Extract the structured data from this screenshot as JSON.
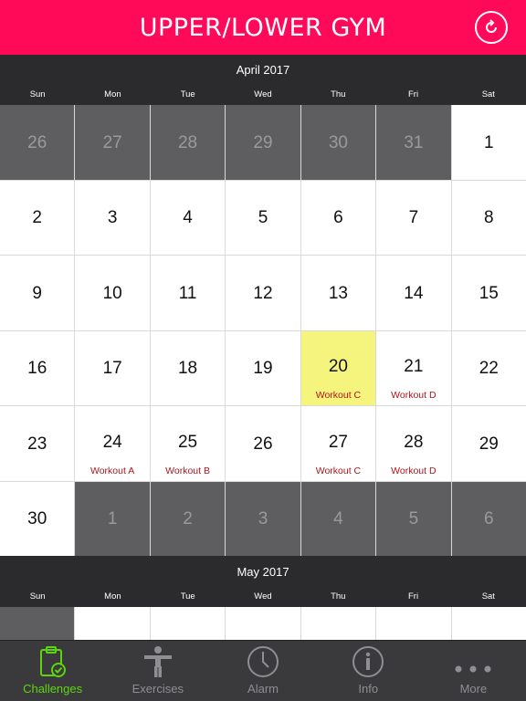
{
  "header": {
    "title": "UPPER/LOWER GYM",
    "refresh_icon": "refresh-icon"
  },
  "april": {
    "title": "April 2017",
    "weekdays": [
      "Sun",
      "Mon",
      "Tue",
      "Wed",
      "Thu",
      "Fri",
      "Sat"
    ],
    "cells": [
      {
        "day": "26",
        "other": true,
        "label": ""
      },
      {
        "day": "27",
        "other": true,
        "label": ""
      },
      {
        "day": "28",
        "other": true,
        "label": ""
      },
      {
        "day": "29",
        "other": true,
        "label": ""
      },
      {
        "day": "30",
        "other": true,
        "label": ""
      },
      {
        "day": "31",
        "other": true,
        "label": ""
      },
      {
        "day": "1",
        "other": false,
        "label": ""
      },
      {
        "day": "2",
        "other": false,
        "label": ""
      },
      {
        "day": "3",
        "other": false,
        "label": ""
      },
      {
        "day": "4",
        "other": false,
        "label": ""
      },
      {
        "day": "5",
        "other": false,
        "label": ""
      },
      {
        "day": "6",
        "other": false,
        "label": ""
      },
      {
        "day": "7",
        "other": false,
        "label": ""
      },
      {
        "day": "8",
        "other": false,
        "label": ""
      },
      {
        "day": "9",
        "other": false,
        "label": ""
      },
      {
        "day": "10",
        "other": false,
        "label": ""
      },
      {
        "day": "11",
        "other": false,
        "label": ""
      },
      {
        "day": "12",
        "other": false,
        "label": ""
      },
      {
        "day": "13",
        "other": false,
        "label": ""
      },
      {
        "day": "14",
        "other": false,
        "label": ""
      },
      {
        "day": "15",
        "other": false,
        "label": ""
      },
      {
        "day": "16",
        "other": false,
        "label": ""
      },
      {
        "day": "17",
        "other": false,
        "label": ""
      },
      {
        "day": "18",
        "other": false,
        "label": ""
      },
      {
        "day": "19",
        "other": false,
        "label": ""
      },
      {
        "day": "20",
        "other": false,
        "today": true,
        "label": "Workout C"
      },
      {
        "day": "21",
        "other": false,
        "label": "Workout D"
      },
      {
        "day": "22",
        "other": false,
        "label": ""
      },
      {
        "day": "23",
        "other": false,
        "label": ""
      },
      {
        "day": "24",
        "other": false,
        "label": "Workout A"
      },
      {
        "day": "25",
        "other": false,
        "label": "Workout B"
      },
      {
        "day": "26",
        "other": false,
        "label": ""
      },
      {
        "day": "27",
        "other": false,
        "label": "Workout C"
      },
      {
        "day": "28",
        "other": false,
        "label": "Workout D"
      },
      {
        "day": "29",
        "other": false,
        "label": ""
      },
      {
        "day": "30",
        "other": false,
        "label": ""
      },
      {
        "day": "1",
        "other": true,
        "label": ""
      },
      {
        "day": "2",
        "other": true,
        "label": ""
      },
      {
        "day": "3",
        "other": true,
        "label": ""
      },
      {
        "day": "4",
        "other": true,
        "label": ""
      },
      {
        "day": "5",
        "other": true,
        "label": ""
      },
      {
        "day": "6",
        "other": true,
        "label": ""
      }
    ]
  },
  "may": {
    "title": "May 2017",
    "weekdays": [
      "Sun",
      "Mon",
      "Tue",
      "Wed",
      "Thu",
      "Fri",
      "Sat"
    ]
  },
  "tabs": [
    {
      "label": "Challenges",
      "icon": "challenges-icon",
      "active": true
    },
    {
      "label": "Exercises",
      "icon": "exercises-icon",
      "active": false
    },
    {
      "label": "Alarm",
      "icon": "alarm-icon",
      "active": false
    },
    {
      "label": "Info",
      "icon": "info-icon",
      "active": false
    },
    {
      "label": "More",
      "icon": "more-icon",
      "active": false
    }
  ],
  "colors": {
    "header": "#ff0a58",
    "today": "#f5f57e",
    "workout_label": "#b0151c",
    "active_tab": "#5dd50e"
  }
}
